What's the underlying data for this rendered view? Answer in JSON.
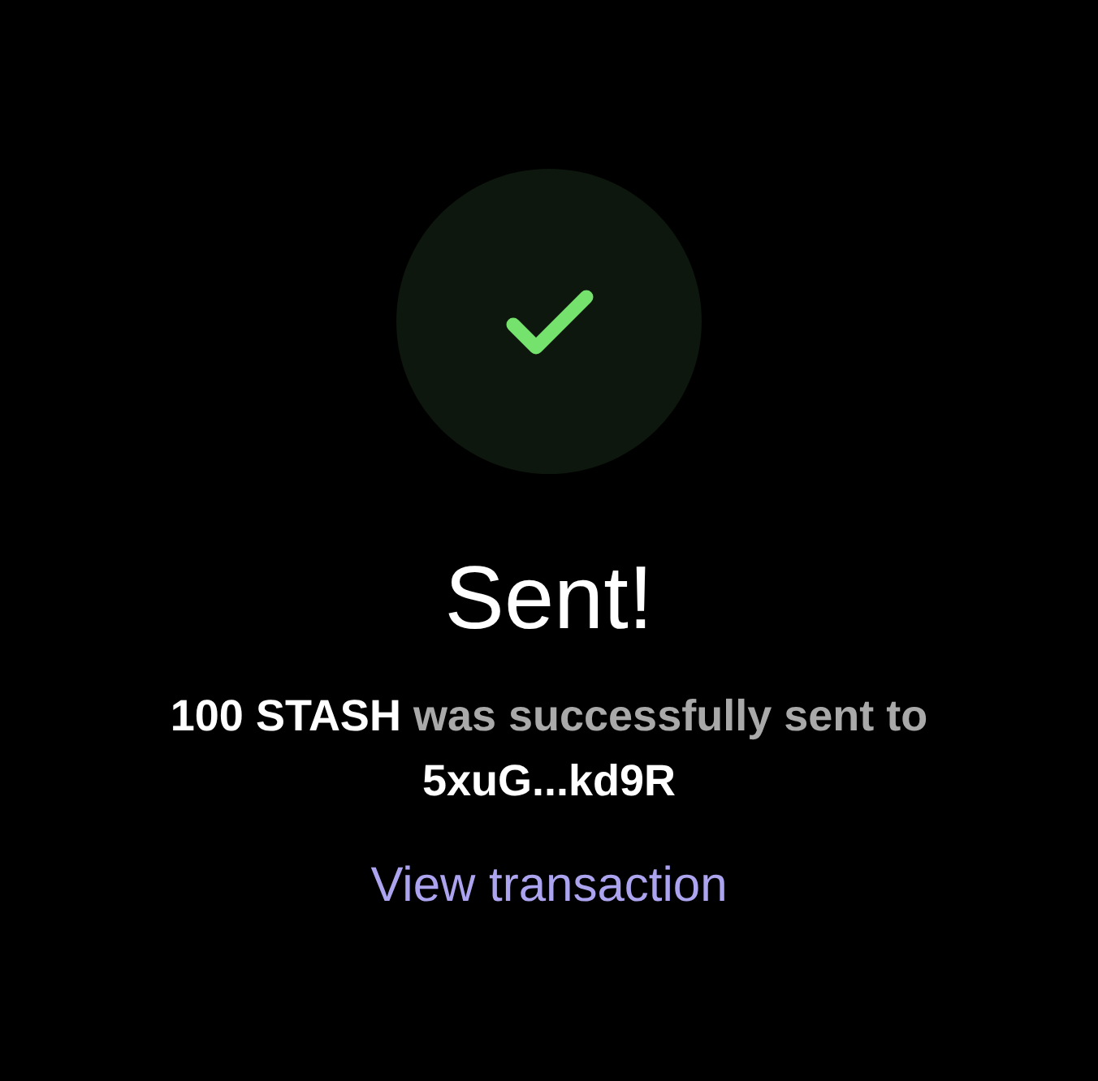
{
  "heading": "Sent!",
  "message": "**100 STASH** was successfully sent to **5xuG...kd9R**",
  "link": "View transaction"
}
